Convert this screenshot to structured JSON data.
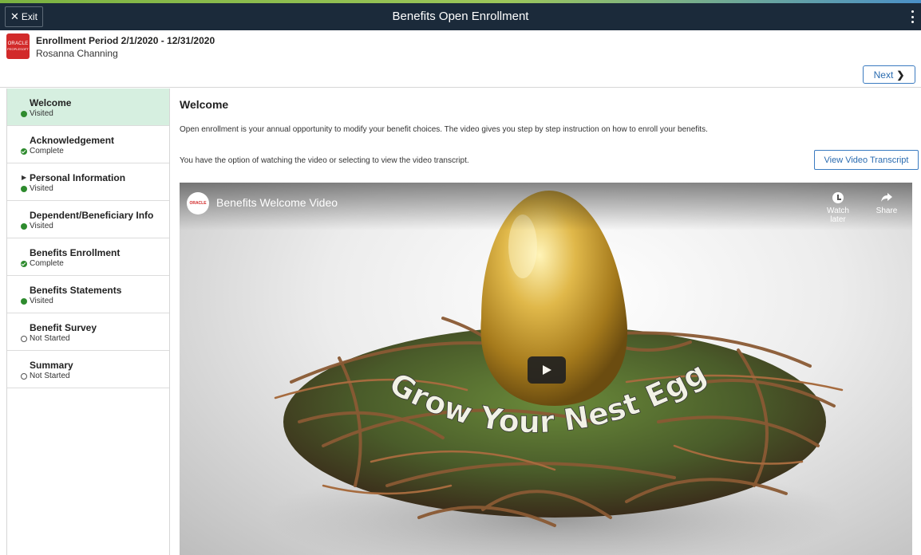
{
  "topbar": {
    "exit_label": "Exit",
    "title": "Benefits Open Enrollment"
  },
  "header": {
    "logo_text": "ORACLE",
    "logo_subtext": "PEOPLESOFT",
    "period": "Enrollment Period 2/1/2020 - 12/31/2020",
    "person": "Rosanna Channing",
    "next_label": "Next"
  },
  "sidebar": {
    "items": [
      {
        "label": "Welcome",
        "status": "Visited",
        "state": "visited",
        "active": true
      },
      {
        "label": "Acknowledgement",
        "status": "Complete",
        "state": "complete"
      },
      {
        "label": "Personal Information",
        "status": "Visited",
        "state": "visited",
        "expandable": true
      },
      {
        "label": "Dependent/Beneficiary Info",
        "status": "Visited",
        "state": "visited"
      },
      {
        "label": "Benefits Enrollment",
        "status": "Complete",
        "state": "complete"
      },
      {
        "label": "Benefits Statements",
        "status": "Visited",
        "state": "visited"
      },
      {
        "label": "Benefit Survey",
        "status": "Not Started",
        "state": "notstarted"
      },
      {
        "label": "Summary",
        "status": "Not Started",
        "state": "notstarted"
      }
    ]
  },
  "main": {
    "title": "Welcome",
    "intro": "Open enrollment is your annual opportunity to modify your benefit choices. The video gives you step by step instruction on how to enroll your benefits.",
    "option_text": "You have the option of watching the video or selecting to view the video transcript.",
    "transcript_button": "View Video Transcript"
  },
  "video": {
    "title": "Benefits Welcome Video",
    "channel_logo_text": "ORACLE",
    "watch_later": "Watch later",
    "share": "Share",
    "overlay_text": "Grow Your Nest Egg"
  },
  "colors": {
    "topbar": "#1b2a3a",
    "active_nav": "#d6efe0",
    "status_green": "#2e8b2e",
    "link_blue": "#2b6cb0",
    "oracle_red": "#d22a2a"
  }
}
